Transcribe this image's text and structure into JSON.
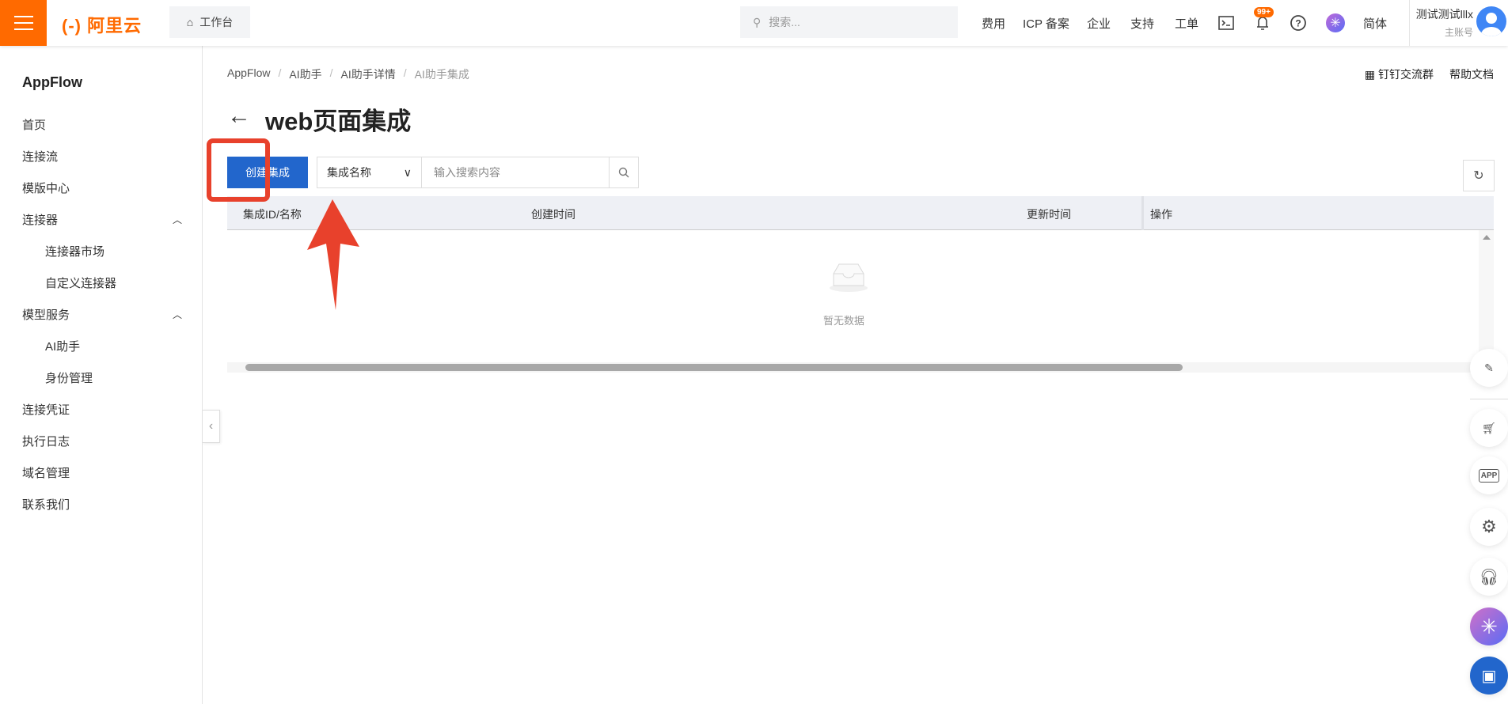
{
  "header": {
    "logo": "阿里云",
    "workbench": "工作台",
    "search_placeholder": "搜索...",
    "nav": [
      "费用",
      "ICP 备案",
      "企业",
      "支持",
      "工单"
    ],
    "badge": "99+",
    "lang": "简体",
    "username": "测试测试lllx",
    "role": "主账号"
  },
  "sidebar": {
    "title": "AppFlow",
    "items": [
      {
        "label": "首页",
        "sub": false
      },
      {
        "label": "连接流",
        "sub": false
      },
      {
        "label": "模版中心",
        "sub": false
      },
      {
        "label": "连接器",
        "sub": false,
        "expanded": true
      },
      {
        "label": "连接器市场",
        "sub": true
      },
      {
        "label": "自定义连接器",
        "sub": true
      },
      {
        "label": "模型服务",
        "sub": false,
        "expanded": true
      },
      {
        "label": "AI助手",
        "sub": true
      },
      {
        "label": "身份管理",
        "sub": true
      },
      {
        "label": "连接凭证",
        "sub": false
      },
      {
        "label": "执行日志",
        "sub": false
      },
      {
        "label": "域名管理",
        "sub": false
      },
      {
        "label": "联系我们",
        "sub": false
      }
    ]
  },
  "breadcrumb": [
    "AppFlow",
    "AI助手",
    "AI助手详情",
    "AI助手集成"
  ],
  "toplinks": {
    "dingtalk": "钉钉交流群",
    "help": "帮助文档"
  },
  "page": {
    "title": "web页面集成",
    "create_button": "创建集成",
    "filter_select": "集成名称",
    "search_placeholder": "输入搜索内容"
  },
  "table": {
    "columns": [
      "集成ID/名称",
      "创建时间",
      "更新时间",
      "操作"
    ],
    "empty": "暂无数据"
  },
  "colors": {
    "brand": "#ff6a00",
    "primary": "#2266cc",
    "annotation": "#e8412c"
  }
}
